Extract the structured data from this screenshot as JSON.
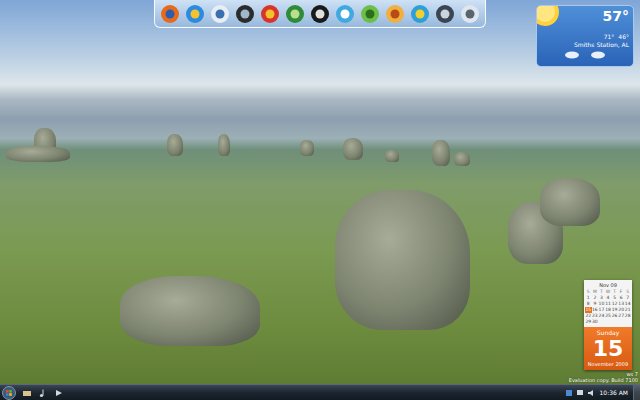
{
  "weather": {
    "temperature": "57°",
    "location": "Smiths Station, AL",
    "high": "71°",
    "low": "46°"
  },
  "calendar": {
    "month_short": "Nov 09",
    "weekday_headers": [
      "S",
      "M",
      "T",
      "W",
      "T",
      "F",
      "S"
    ],
    "days": [
      {
        "label": "1",
        "selected": false
      },
      {
        "label": "2",
        "selected": false
      },
      {
        "label": "3",
        "selected": false
      },
      {
        "label": "4",
        "selected": false
      },
      {
        "label": "5",
        "selected": false
      },
      {
        "label": "6",
        "selected": false
      },
      {
        "label": "7",
        "selected": false
      },
      {
        "label": "8",
        "selected": false
      },
      {
        "label": "9",
        "selected": false
      },
      {
        "label": "10",
        "selected": false
      },
      {
        "label": "11",
        "selected": false
      },
      {
        "label": "12",
        "selected": false
      },
      {
        "label": "13",
        "selected": false
      },
      {
        "label": "14",
        "selected": false
      },
      {
        "label": "15",
        "selected": true
      },
      {
        "label": "16",
        "selected": false
      },
      {
        "label": "17",
        "selected": false
      },
      {
        "label": "18",
        "selected": false
      },
      {
        "label": "19",
        "selected": false
      },
      {
        "label": "20",
        "selected": false
      },
      {
        "label": "21",
        "selected": false
      },
      {
        "label": "22",
        "selected": false
      },
      {
        "label": "23",
        "selected": false
      },
      {
        "label": "24",
        "selected": false
      },
      {
        "label": "25",
        "selected": false
      },
      {
        "label": "26",
        "selected": false
      },
      {
        "label": "27",
        "selected": false
      },
      {
        "label": "28",
        "selected": false
      },
      {
        "label": "29",
        "selected": false
      },
      {
        "label": "30",
        "selected": false
      }
    ],
    "weekday": "Sunday",
    "day": "15",
    "month_year": "November 2009"
  },
  "watermark": [
    "ws 7",
    "Evaluation copy. Build 7100"
  ],
  "taskbar": {
    "clock": "10:36 AM"
  }
}
